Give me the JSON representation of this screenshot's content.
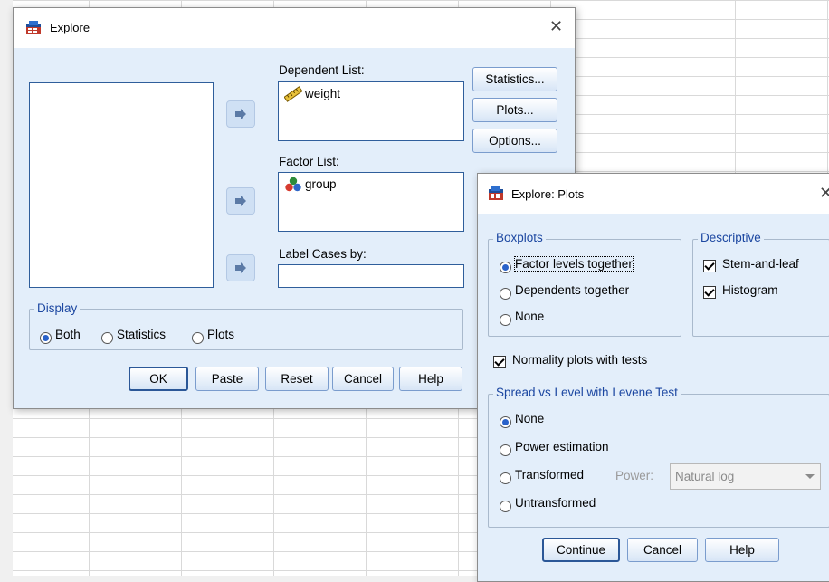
{
  "explore": {
    "title": "Explore",
    "dependent_list_label": "Dependent List:",
    "dependent_items": [
      "weight"
    ],
    "factor_list_label": "Factor List:",
    "factor_items": [
      "group"
    ],
    "label_cases_label": "Label Cases by:",
    "side_buttons": [
      "Statistics...",
      "Plots...",
      "Options..."
    ],
    "display_group": "Display",
    "display_options": [
      "Both",
      "Statistics",
      "Plots"
    ],
    "display_selected": "Both",
    "bottom_buttons": [
      "OK",
      "Paste",
      "Reset",
      "Cancel",
      "Help"
    ]
  },
  "plots": {
    "title": "Explore: Plots",
    "boxplots_group": "Boxplots",
    "boxplots_options": [
      "Factor levels together",
      "Dependents together",
      "None"
    ],
    "boxplots_selected": "Factor levels together",
    "descriptive_group": "Descriptive",
    "descriptive_options": [
      {
        "label": "Stem-and-leaf",
        "checked": true
      },
      {
        "label": "Histogram",
        "checked": true
      }
    ],
    "normality_label": "Normality plots with tests",
    "normality_checked": true,
    "spread_group": "Spread vs Level with Levene Test",
    "spread_options": [
      "None",
      "Power estimation",
      "Transformed",
      "Untransformed"
    ],
    "spread_selected": "None",
    "power_label": "Power:",
    "power_value": "Natural log",
    "buttons": [
      "Continue",
      "Cancel",
      "Help"
    ]
  },
  "icons": {
    "app_icon": "spss-dialog-icon",
    "scale_variable": "ruler-icon",
    "nominal_variable": "three-circles-icon",
    "move_arrow": "right-arrow-icon"
  },
  "colors": {
    "dialog_body": "#e3eefa",
    "group_label": "#1c47a1",
    "radio_selected": "#2a62c9",
    "list_border": "#2f5e9b"
  }
}
